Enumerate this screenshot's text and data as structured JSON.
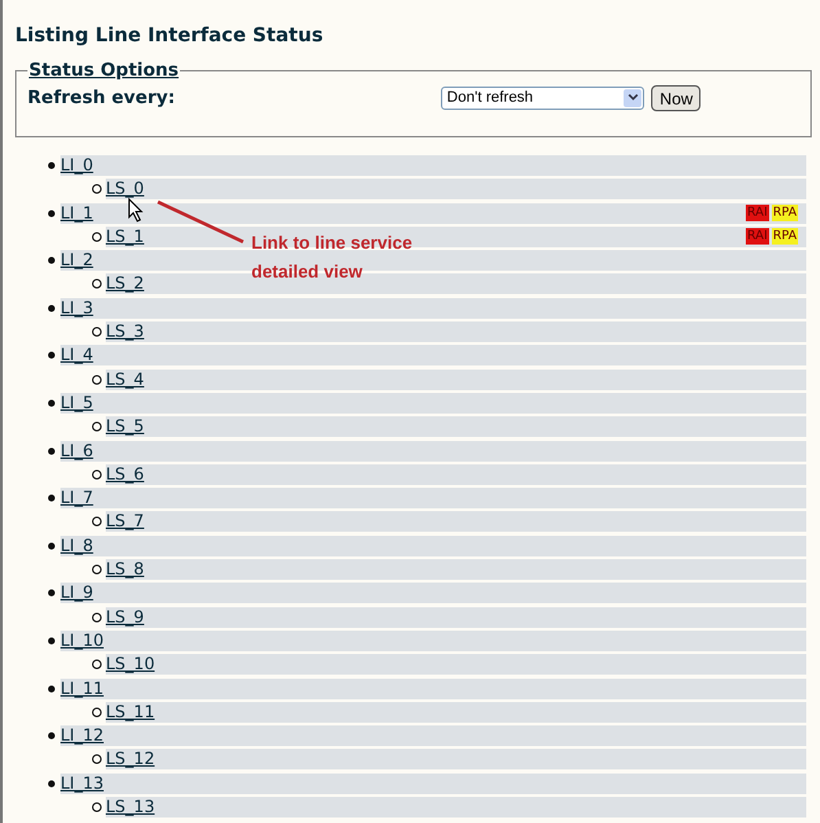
{
  "page_title": "Listing Line Interface Status",
  "status_options": {
    "legend": "Status Options",
    "refresh_label": "Refresh every:",
    "refresh_select": "Don't refresh",
    "now_button": "Now"
  },
  "interfaces": [
    {
      "label": "LI_0",
      "children": [
        {
          "label": "LS_0"
        }
      ]
    },
    {
      "label": "LI_1",
      "badges": [
        {
          "text": "RAI",
          "color": "#e01010"
        },
        {
          "text": "RPA",
          "color": "#f5f020"
        }
      ],
      "children": [
        {
          "label": "LS_1",
          "badges": [
            {
              "text": "RAI",
              "color": "#e01010"
            },
            {
              "text": "RPA",
              "color": "#f5f020"
            }
          ]
        }
      ]
    },
    {
      "label": "LI_2",
      "children": [
        {
          "label": "LS_2"
        }
      ]
    },
    {
      "label": "LI_3",
      "children": [
        {
          "label": "LS_3"
        }
      ]
    },
    {
      "label": "LI_4",
      "children": [
        {
          "label": "LS_4"
        }
      ]
    },
    {
      "label": "LI_5",
      "children": [
        {
          "label": "LS_5"
        }
      ]
    },
    {
      "label": "LI_6",
      "children": [
        {
          "label": "LS_6"
        }
      ]
    },
    {
      "label": "LI_7",
      "children": [
        {
          "label": "LS_7"
        }
      ]
    },
    {
      "label": "LI_8",
      "children": [
        {
          "label": "LS_8"
        }
      ]
    },
    {
      "label": "LI_9",
      "children": [
        {
          "label": "LS_9"
        }
      ]
    },
    {
      "label": "LI_10",
      "children": [
        {
          "label": "LS_10"
        }
      ]
    },
    {
      "label": "LI_11",
      "children": [
        {
          "label": "LS_11"
        }
      ]
    },
    {
      "label": "LI_12",
      "children": [
        {
          "label": "LS_12"
        }
      ]
    },
    {
      "label": "LI_13",
      "children": [
        {
          "label": "LS_13"
        }
      ]
    }
  ],
  "annotation": {
    "text": "Link to line service detailed view"
  }
}
